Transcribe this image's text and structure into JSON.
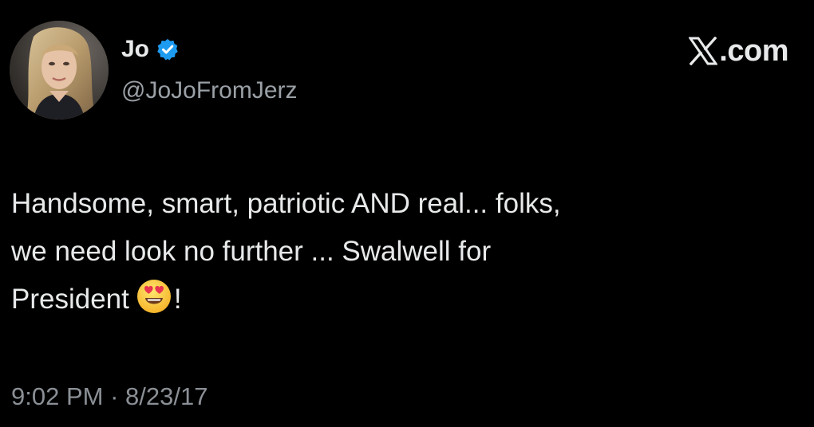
{
  "tweet": {
    "author": {
      "display_name": "Jo",
      "handle": "@JoJoFromJerz",
      "verified_icon": "verified-badge-icon",
      "avatar_icon": "profile-photo"
    },
    "brand": {
      "logo_icon": "x-logo-icon",
      "domain": ".com"
    },
    "text": {
      "line1": "Handsome, smart, patriotic AND real... folks,",
      "line2": "we need look no further ... Swalwell for",
      "line3": "President",
      "line3_emoji": "smiling-face-with-heart-eyes-emoji",
      "line3_end": "!"
    },
    "timestamp": {
      "time": "9:02 PM",
      "separator": "·",
      "date": "8/23/17"
    }
  },
  "colors": {
    "background": "#000000",
    "text_primary": "#e7e9ea",
    "text_secondary": "#8b9096",
    "verified_blue": "#1d9bf0"
  }
}
